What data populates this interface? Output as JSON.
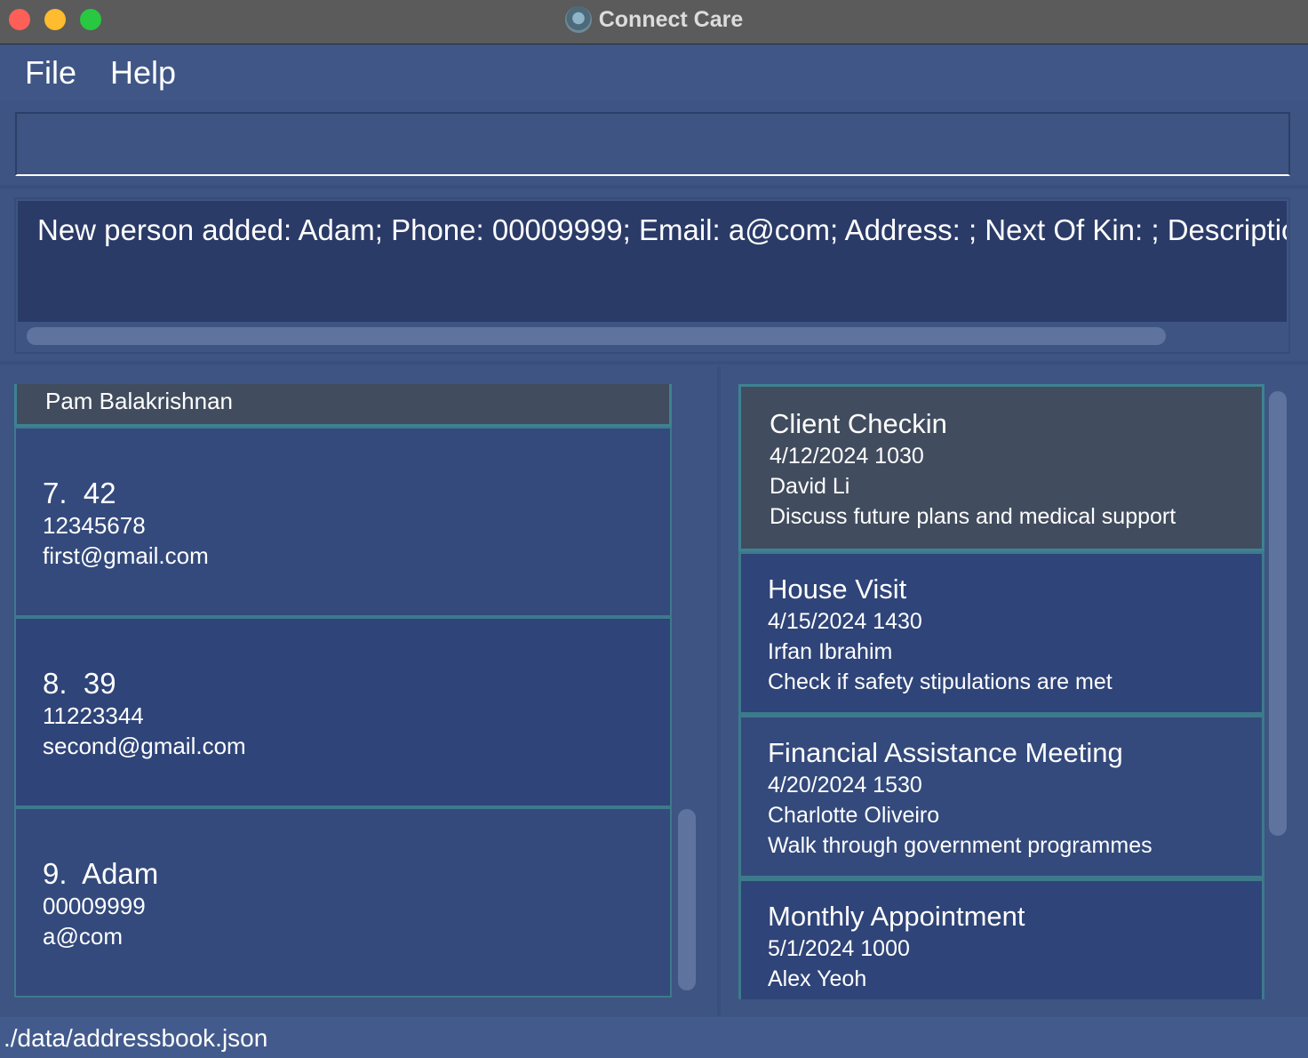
{
  "window": {
    "title": "Connect Care"
  },
  "menu": {
    "file": "File",
    "help": "Help"
  },
  "command": {
    "value": ""
  },
  "result": {
    "text": "New person added: Adam; Phone: 00009999; Email: a@com; Address: ; Next Of Kin: ; Description"
  },
  "persons": {
    "partial": {
      "name": "Pam Balakrishnan"
    },
    "items": [
      {
        "index": "7.",
        "name": "42",
        "phone": "12345678",
        "email": "first@gmail.com"
      },
      {
        "index": "8.",
        "name": "39",
        "phone": "11223344",
        "email": "second@gmail.com"
      },
      {
        "index": "9.",
        "name": "Adam",
        "phone": "00009999",
        "email": "a@com"
      }
    ]
  },
  "appointments": {
    "items": [
      {
        "title": "Client Checkin",
        "datetime": "4/12/2024 1030",
        "client": "David Li",
        "description": "Discuss future plans and medical support"
      },
      {
        "title": "House Visit",
        "datetime": "4/15/2024 1430",
        "client": "Irfan Ibrahim",
        "description": "Check if safety stipulations are met"
      },
      {
        "title": "Financial Assistance Meeting",
        "datetime": "4/20/2024 1530",
        "client": "Charlotte Oliveiro",
        "description": "Walk through government programmes"
      },
      {
        "title": "Monthly Appointment",
        "datetime": "5/1/2024 1000",
        "client": "Alex Yeoh",
        "description": ""
      }
    ]
  },
  "status": {
    "path": "./data/addressbook.json"
  }
}
